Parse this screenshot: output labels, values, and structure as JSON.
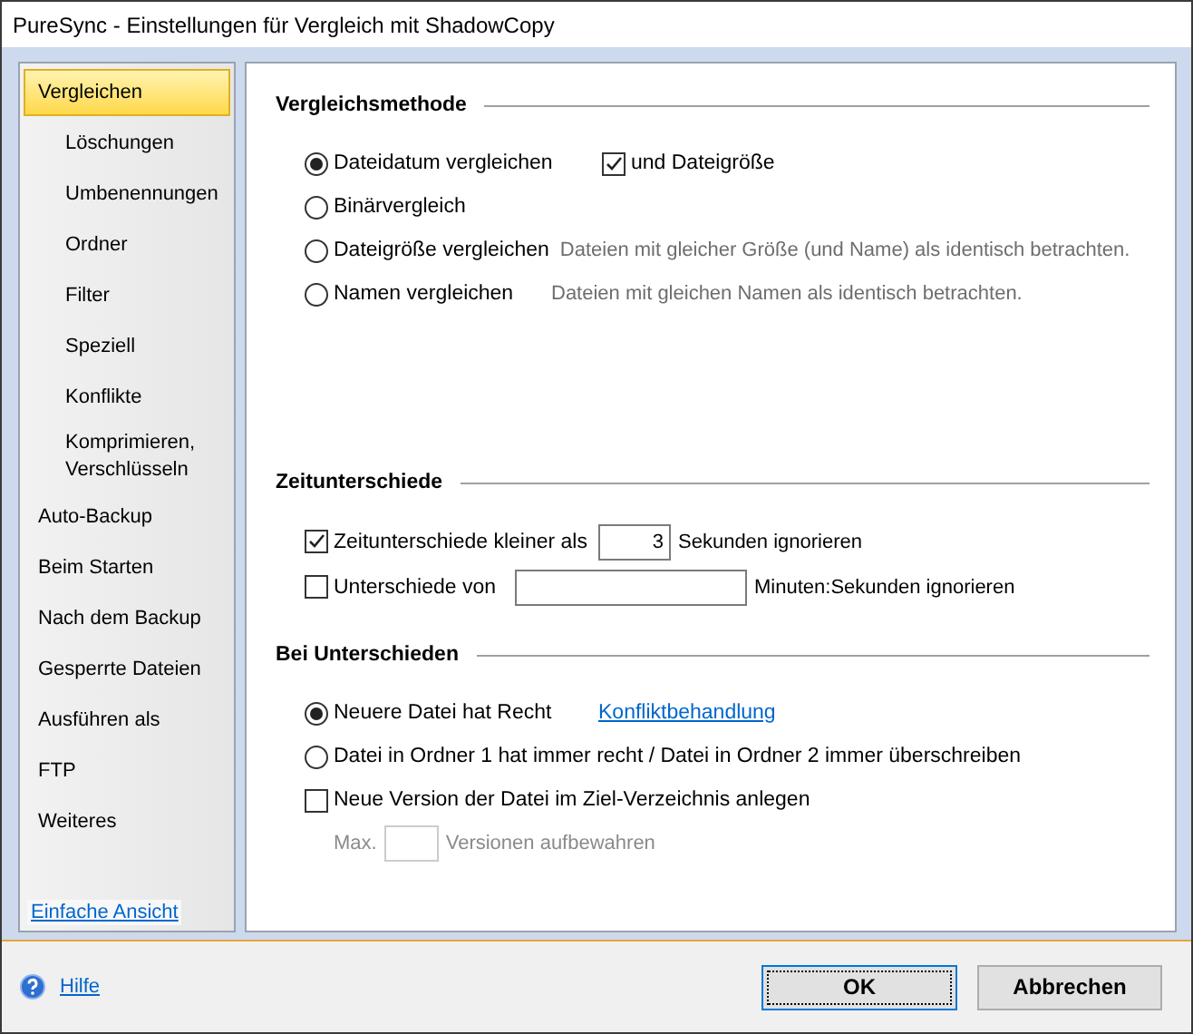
{
  "window": {
    "title": "PureSync - Einstellungen für Vergleich mit ShadowCopy"
  },
  "sidebar": {
    "items": [
      {
        "label": "Vergleichen",
        "selected": true,
        "children": [
          {
            "label": "Löschungen",
            "selected": false
          },
          {
            "label": "Umbenennungen",
            "selected": false
          },
          {
            "label": "Ordner",
            "selected": false
          },
          {
            "label": "Filter",
            "selected": false
          },
          {
            "label": "Speziell",
            "selected": false
          },
          {
            "label": "Konflikte",
            "selected": false
          },
          {
            "label": "Komprimieren, Verschlüsseln",
            "selected": false
          }
        ]
      },
      {
        "label": "Auto-Backup",
        "selected": false
      },
      {
        "label": "Beim Starten",
        "selected": false
      },
      {
        "label": "Nach dem Backup",
        "selected": false
      },
      {
        "label": "Gesperrte Dateien",
        "selected": false
      },
      {
        "label": "Ausführen als",
        "selected": false
      },
      {
        "label": "FTP",
        "selected": false
      },
      {
        "label": "Weiteres",
        "selected": false
      }
    ],
    "footer_link": "Einfache Ansicht"
  },
  "sections": [
    {
      "title": "Vergleichsmethode",
      "rows": [
        {
          "disabled": false,
          "controls": [
            {
              "kind": "radio",
              "label": "Dateidatum vergleichen",
              "selected": true
            },
            {
              "kind": "checkbox",
              "label": "und Dateigröße",
              "checked": true
            }
          ]
        },
        {
          "disabled": false,
          "controls": [
            {
              "kind": "radio",
              "label": "Binärvergleich",
              "selected": false
            }
          ]
        },
        {
          "disabled": false,
          "controls": [
            {
              "kind": "radio",
              "label": "Dateigröße vergleichen",
              "selected": false
            },
            {
              "kind": "hint",
              "text": "Dateien mit gleicher Größe (und Name) als identisch betrachten."
            }
          ]
        },
        {
          "disabled": false,
          "controls": [
            {
              "kind": "radio",
              "label": "Namen vergleichen",
              "selected": false
            },
            {
              "kind": "hint",
              "text": "Dateien mit gleichen Namen als identisch betrachten."
            }
          ]
        }
      ]
    },
    {
      "title": "Zeitunterschiede",
      "rows": [
        {
          "disabled": false,
          "controls": [
            {
              "kind": "checkbox",
              "label": "Zeitunterschiede kleiner als",
              "checked": true
            },
            {
              "kind": "field",
              "value": "3"
            },
            {
              "kind": "text",
              "text": "Sekunden ignorieren"
            }
          ]
        },
        {
          "disabled": false,
          "controls": [
            {
              "kind": "checkbox",
              "label": "Unterschiede von",
              "checked": false
            },
            {
              "kind": "field"
            },
            {
              "kind": "text",
              "text": "Minuten:Sekunden ignorieren"
            }
          ]
        }
      ]
    },
    {
      "title": "Bei Unterschieden",
      "rows": [
        {
          "disabled": false,
          "controls": [
            {
              "kind": "radio",
              "label": "Neuere Datei hat Recht",
              "selected": true
            },
            {
              "kind": "link",
              "text": "Konfliktbehandlung"
            }
          ]
        },
        {
          "disabled": false,
          "controls": [
            {
              "kind": "radio",
              "label": "Datei in Ordner 1 hat immer recht / Datei in Ordner 2 immer überschreiben",
              "selected": false
            }
          ]
        },
        {
          "disabled": false,
          "controls": [
            {
              "kind": "checkbox",
              "label": "Neue Version der Datei im Ziel-Verzeichnis anlegen",
              "checked": false
            }
          ]
        },
        {
          "disabled": true,
          "controls": [
            {
              "kind": "text",
              "text": "Max."
            },
            {
              "kind": "field"
            },
            {
              "kind": "text",
              "text": "Versionen aufbewahren"
            }
          ]
        }
      ]
    }
  ],
  "footer": {
    "help_link": "Hilfe",
    "buttons": [
      {
        "label": "OK",
        "default": true
      },
      {
        "label": "Abbrechen",
        "default": false
      }
    ]
  }
}
